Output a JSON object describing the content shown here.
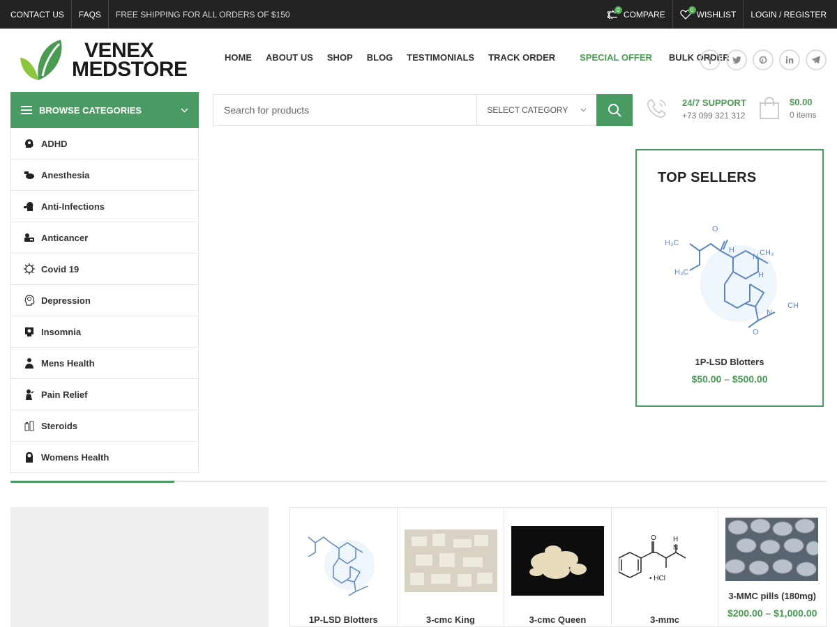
{
  "topbar": {
    "contact": "CONTACT US",
    "faqs": "FAQS",
    "shipping": "FREE SHIPPING FOR ALL ORDERS OF $150",
    "compare": "COMPARE",
    "compare_count": "0",
    "wishlist": "WISHLIST",
    "wishlist_count": "0",
    "login": "LOGIN / REGISTER"
  },
  "logo": {
    "line1": "VENEX",
    "line2": "MEDSTORE"
  },
  "nav": {
    "items": [
      "HOME",
      "ABOUT US",
      "SHOP",
      "BLOG",
      "TESTIMONIALS",
      "TRACK ORDER"
    ],
    "special": "SPECIAL OFFER",
    "bulk": "BULK ORDER"
  },
  "socials": [
    "facebook-icon",
    "twitter-icon",
    "pinterest-icon",
    "linkedin-icon",
    "telegram-icon"
  ],
  "categories": {
    "title": "BROWSE CATEGORIES",
    "items": [
      "ADHD",
      "Anesthesia",
      "Anti-Infections",
      "Anticancer",
      "Covid 19",
      "Depression",
      "Insomnia",
      "Mens Health",
      "Pain Relief",
      "Steroids",
      "Womens Health"
    ]
  },
  "search": {
    "placeholder": "Search for products",
    "category": "SELECT CATEGORY"
  },
  "support": {
    "title": "24/7 SUPPORT",
    "phone": "+73 099 321 312"
  },
  "cart": {
    "total": "$0.00",
    "items": "0 items"
  },
  "top_sellers": {
    "title": "TOP SELLERS",
    "product_name": "1P-LSD Blotters",
    "price": "$50.00 – $500.00"
  },
  "products": [
    {
      "name": "1P-LSD Blotters",
      "price": ""
    },
    {
      "name": "3-cmc King",
      "price": ""
    },
    {
      "name": "3-cmc Queen",
      "price": ""
    },
    {
      "name": "3-mmc",
      "price": ""
    },
    {
      "name": "3-MMC pills (180mg)",
      "price": "$200.00 – $1,000.00"
    }
  ],
  "colors": {
    "accent": "#4a9a64",
    "price": "#4a9a53",
    "topbar": "#222222"
  }
}
